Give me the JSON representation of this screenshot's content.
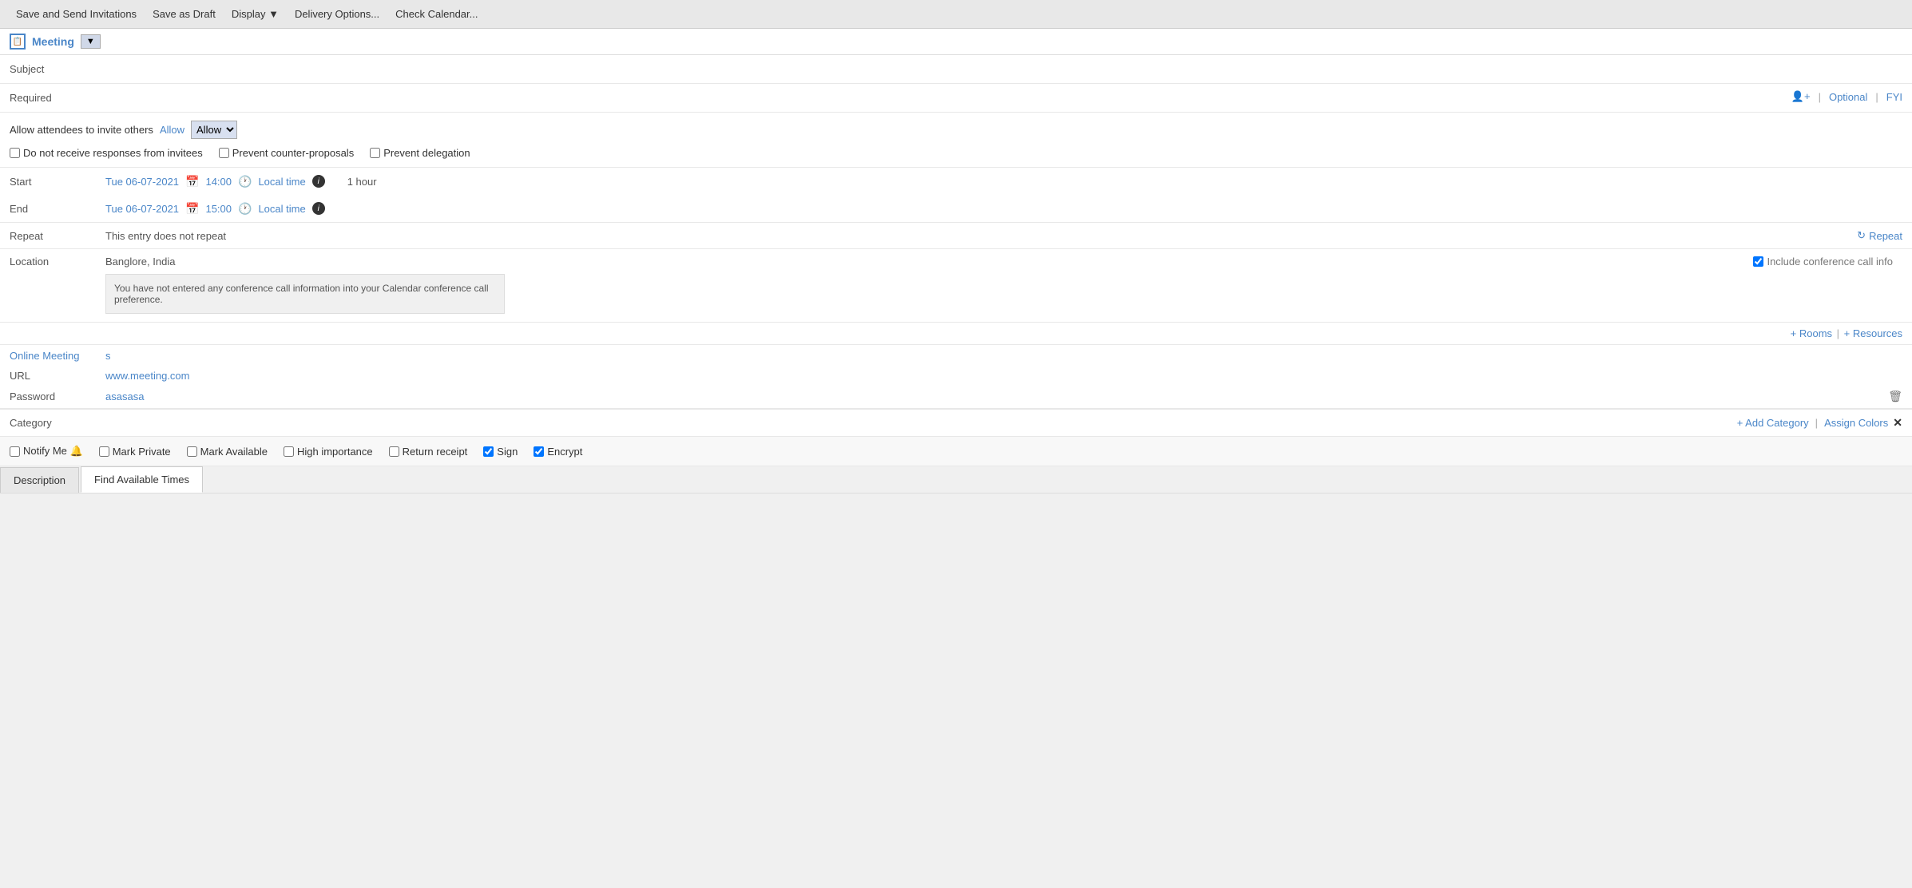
{
  "toolbar": {
    "save_send_label": "Save and Send Invitations",
    "save_draft_label": "Save as Draft",
    "display_label": "Display ▼",
    "delivery_options_label": "Delivery Options...",
    "check_calendar_label": "Check Calendar..."
  },
  "title_bar": {
    "icon_label": "📅",
    "meeting_label": "Meeting",
    "dropdown_arrow": "▼"
  },
  "fields": {
    "subject_label": "Subject",
    "required_label": "Required",
    "required_right_actions": "+ | Optional | FYI",
    "attendees_label": "Allow attendees to invite others",
    "allow_label": "Allow",
    "checkbox_no_responses": "Do not receive responses from invitees",
    "checkbox_no_counter": "Prevent counter-proposals",
    "checkbox_no_delegation": "Prevent delegation",
    "start_label": "Start",
    "start_date": "Tue 06-07-2021",
    "start_time": "14:00",
    "start_timezone": "Local time",
    "end_label": "End",
    "end_date": "Tue 06-07-2021",
    "end_time": "15:00",
    "end_timezone": "Local time",
    "duration": "1 hour",
    "repeat_label": "Repeat",
    "repeat_value": "This entry does not repeat",
    "repeat_action": "Repeat",
    "location_label": "Location",
    "location_value": "Banglore, India",
    "conference_label": "Include conference call info",
    "conference_note": "You have not entered any conference call information into your Calendar conference call preference.",
    "rooms_label": "+ Rooms",
    "resources_label": "+ Resources",
    "online_label": "Online Meeting",
    "online_value": "s",
    "url_label": "URL",
    "url_value": "www.meeting.com",
    "password_label": "Password",
    "password_value": "asasasa",
    "category_label": "Category",
    "add_category_label": "+ Add Category",
    "assign_colors_label": "Assign Colors",
    "x_label": "✕"
  },
  "bottom_checks": {
    "notify_label": "Notify Me 🔔",
    "mark_private_label": "Mark Private",
    "mark_available_label": "Mark Available",
    "high_importance_label": "High importance",
    "return_receipt_label": "Return receipt",
    "sign_label": "Sign",
    "encrypt_label": "Encrypt",
    "sign_checked": true,
    "encrypt_checked": true
  },
  "tabs": {
    "description_label": "Description",
    "find_times_label": "Find Available Times"
  }
}
